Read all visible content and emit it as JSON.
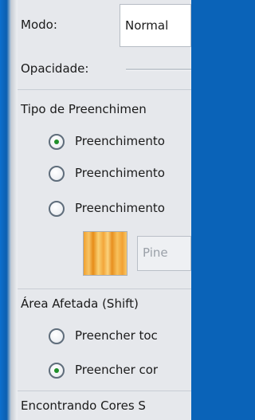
{
  "mode": {
    "label": "Modo:",
    "value": "Normal"
  },
  "opacity": {
    "label": "Opacidade:"
  },
  "fill_type": {
    "title": "Tipo de Preenchimen",
    "options": [
      {
        "label": "Preenchimento",
        "checked": true
      },
      {
        "label": "Preenchimento",
        "checked": false
      },
      {
        "label": "Preenchimento",
        "checked": false
      }
    ],
    "pattern_name": "Pine"
  },
  "affected_area": {
    "title": "Área Afetada (Shift)",
    "options": [
      {
        "label": "Preencher toc",
        "checked": false
      },
      {
        "label": "Preencher cor",
        "checked": true
      }
    ]
  },
  "finding_colors": {
    "title": "Encontrando Cores S"
  }
}
